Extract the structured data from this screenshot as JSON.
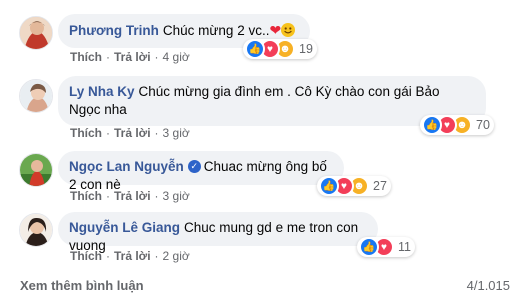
{
  "comments": [
    {
      "author": "Phương Trinh",
      "text": "Chúc mừng 2 vc..",
      "emoji": [
        "heart",
        "smile"
      ],
      "like": "Thích",
      "reply": "Trả lời",
      "time": "4 giờ",
      "reaction_count": "19",
      "reactions": [
        "like-icon",
        "love-icon",
        "care-icon"
      ],
      "avatar_colors": [
        "#c0392b",
        "#e8c6a8"
      ]
    },
    {
      "author": "Ly Nha Ky",
      "text": "Chúc mừng gia đình em . Cô Kỳ chào con gái Bảo Ngọc nha",
      "like": "Thích",
      "reply": "Trả lời",
      "time": "3 giờ",
      "reaction_count": "70",
      "reactions": [
        "like-icon",
        "love-icon",
        "care-icon"
      ],
      "avatar_colors": [
        "#e9eef2",
        "#d9a58c"
      ]
    },
    {
      "author": "Ngọc Lan Nguyễn",
      "verified": true,
      "text": "Chuac mừng ông bố 2 con nè",
      "like": "Thích",
      "reply": "Trả lời",
      "time": "3 giờ",
      "reaction_count": "27",
      "reactions": [
        "like-icon",
        "love-icon",
        "care-icon"
      ],
      "avatar_colors": [
        "#3d7a2e",
        "#d23b2a"
      ]
    },
    {
      "author": "Nguyễn Lê Giang",
      "text": "Chuc mung gd e me tron con vuong",
      "like": "Thích",
      "reply": "Trả lời",
      "time": "2 giờ",
      "reaction_count": "11",
      "reactions": [
        "like-icon",
        "love-icon"
      ],
      "avatar_colors": [
        "#f3ede6",
        "#2b1f1a"
      ]
    }
  ],
  "footer": {
    "more": "Xem thêm bình luận",
    "count": "4/1.015"
  },
  "colors": {
    "author": "#385898",
    "bubble": "#f0f2f5",
    "like": "#1877f2",
    "love": "#f33e58",
    "care": "#f7b125"
  }
}
